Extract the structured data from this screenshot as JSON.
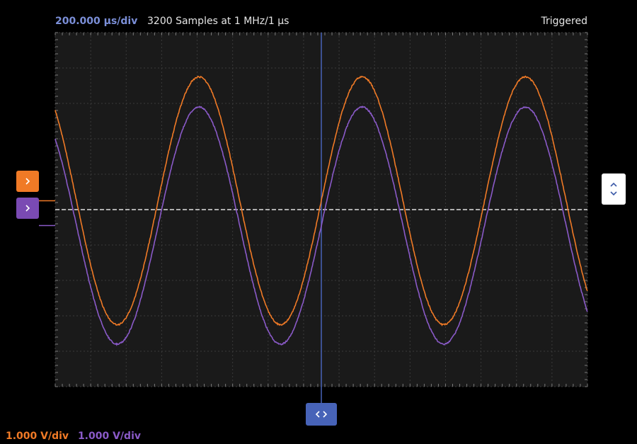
{
  "header": {
    "timebase": "200.000 µs/div",
    "samples": "3200 Samples at 1 MHz/1 µs",
    "trigger_status": "Triggered"
  },
  "footer": {
    "ch1_scale": "1.000 V/div",
    "ch2_scale": "1.000 V/div"
  },
  "colors": {
    "ch1": "#f07a26",
    "ch2": "#8a5ac8",
    "timebase": "#7b8fd8",
    "grid": "#3a3a3a",
    "plot_bg": "#1a1a1a",
    "cursor": "#4763b8",
    "trigger_level": "#e0e0e0"
  },
  "icons": {
    "ch1_offset": "chevron-right-icon",
    "ch2_offset": "chevron-right-icon",
    "trigger_level": "chevron-up-down-icon",
    "time_offset": "chevron-left-right-icon"
  },
  "chart_data": {
    "type": "line",
    "x_divisions": 15,
    "y_divisions": 10,
    "series": [
      {
        "ch": "1",
        "amplitude_div": 3.5,
        "offset_div": 0.25,
        "period_div": 4.6,
        "phase_div": 0.0
      },
      {
        "ch": "2",
        "amplitude_div": 3.35,
        "offset_div": -0.45,
        "period_div": 4.6,
        "phase_div": 0.0
      }
    ],
    "trigger_level_div": 0.0,
    "time_cursor_div": 7.5
  }
}
